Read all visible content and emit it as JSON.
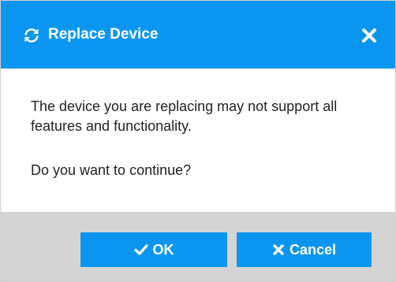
{
  "dialog": {
    "title": "Replace Device",
    "title_icon": "refresh-icon",
    "close_icon": "close-icon",
    "message": "The device you are replacing may not support all features and functionality.",
    "question": "Do you want to continue?",
    "buttons": {
      "ok": {
        "label": "OK",
        "icon": "check-icon"
      },
      "cancel": {
        "label": "Cancel",
        "icon": "x-icon"
      }
    }
  },
  "colors": {
    "accent": "#0a96f0",
    "footer_bg": "#d4d4d4",
    "text": "#222222"
  }
}
